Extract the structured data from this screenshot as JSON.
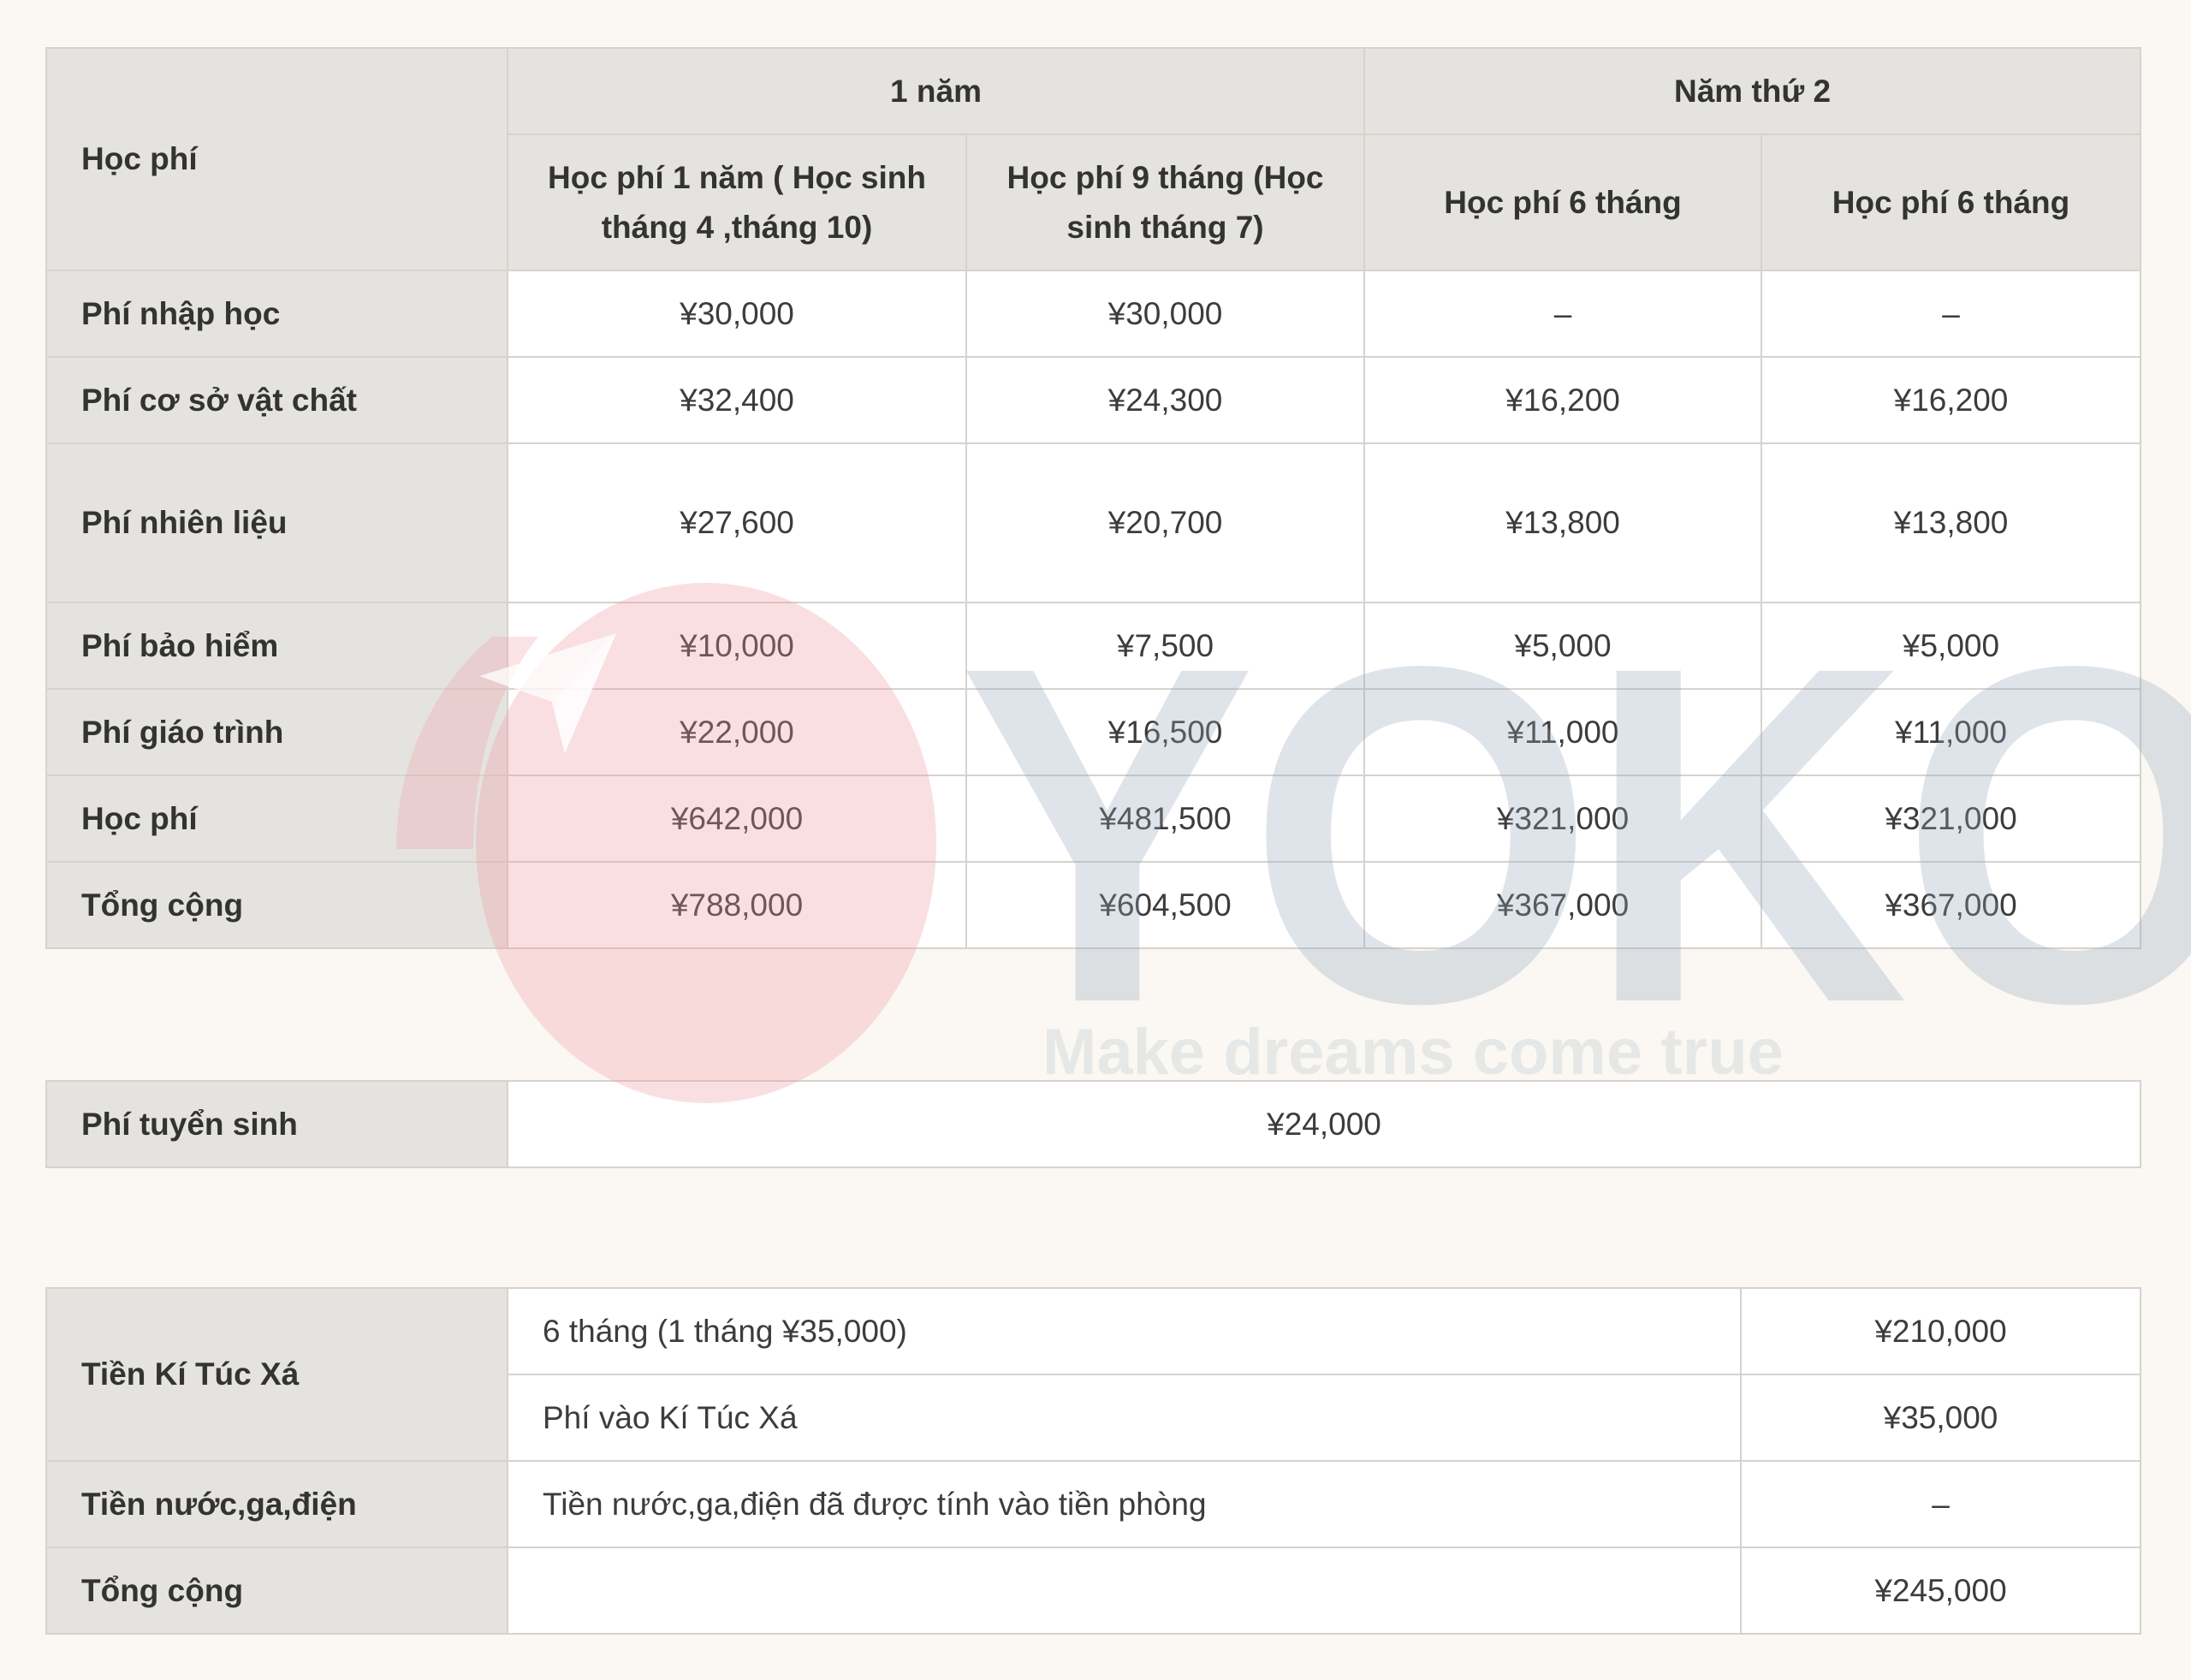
{
  "fees_table": {
    "corner_label": "Học phí",
    "group_headers": [
      "1 năm",
      "Năm thứ 2"
    ],
    "column_headers": [
      "Học phí 1 năm ( Học sinh tháng 4 ,tháng 10)",
      "Học phí 9 tháng (Học sinh tháng 7)",
      "Học phí 6 tháng",
      "Học phí 6 tháng"
    ],
    "rows": [
      {
        "label": "Phí nhập học",
        "values": [
          "¥30,000",
          "¥30,000",
          "–",
          "–"
        ]
      },
      {
        "label": "Phí cơ sở vật chất",
        "values": [
          "¥32,400",
          "¥24,300",
          "¥16,200",
          "¥16,200"
        ]
      },
      {
        "label": "Phí nhiên liệu",
        "values": [
          "¥27,600",
          "¥20,700",
          "¥13,800",
          "¥13,800"
        ]
      },
      {
        "label": "Phí bảo hiểm",
        "values": [
          "¥10,000",
          "¥7,500",
          "¥5,000",
          "¥5,000"
        ]
      },
      {
        "label": "Phí giáo trình",
        "values": [
          "¥22,000",
          "¥16,500",
          "¥11,000",
          "¥11,000"
        ]
      },
      {
        "label": "Học phí",
        "values": [
          "¥642,000",
          "¥481,500",
          "¥321,000",
          "¥321,000"
        ]
      },
      {
        "label": "Tổng cộng",
        "values": [
          "¥788,000",
          "¥604,500",
          "¥367,000",
          "¥367,000"
        ]
      }
    ]
  },
  "admission_table": {
    "label": "Phí tuyển sinh",
    "value": "¥24,000"
  },
  "dorm_table": {
    "group_label": "Tiền Kí Túc Xá",
    "rows": [
      {
        "desc": "6 tháng (1 tháng ¥35,000)",
        "amount": "¥210,000"
      },
      {
        "desc": "Phí vào Kí Túc Xá",
        "amount": "¥35,000"
      }
    ],
    "utilities": {
      "label": "Tiền nước,ga,điện",
      "desc": "Tiền nước,ga,điện đã được tính vào tiền phòng",
      "amount": "–"
    },
    "total": {
      "label": "Tổng cộng",
      "desc": "",
      "amount": "¥245,000"
    }
  },
  "watermark": {
    "brand": "YOKO",
    "tagline": "Make dreams come true",
    "colors": {
      "circle": "#f0a0a8",
      "text": "#96a5b9"
    }
  },
  "colors": {
    "page_bg": "#fbf8f3",
    "header_bg": "#e5e3df",
    "cell_bg": "#ffffff",
    "border": "#d6d3cd",
    "text": "#333333"
  }
}
